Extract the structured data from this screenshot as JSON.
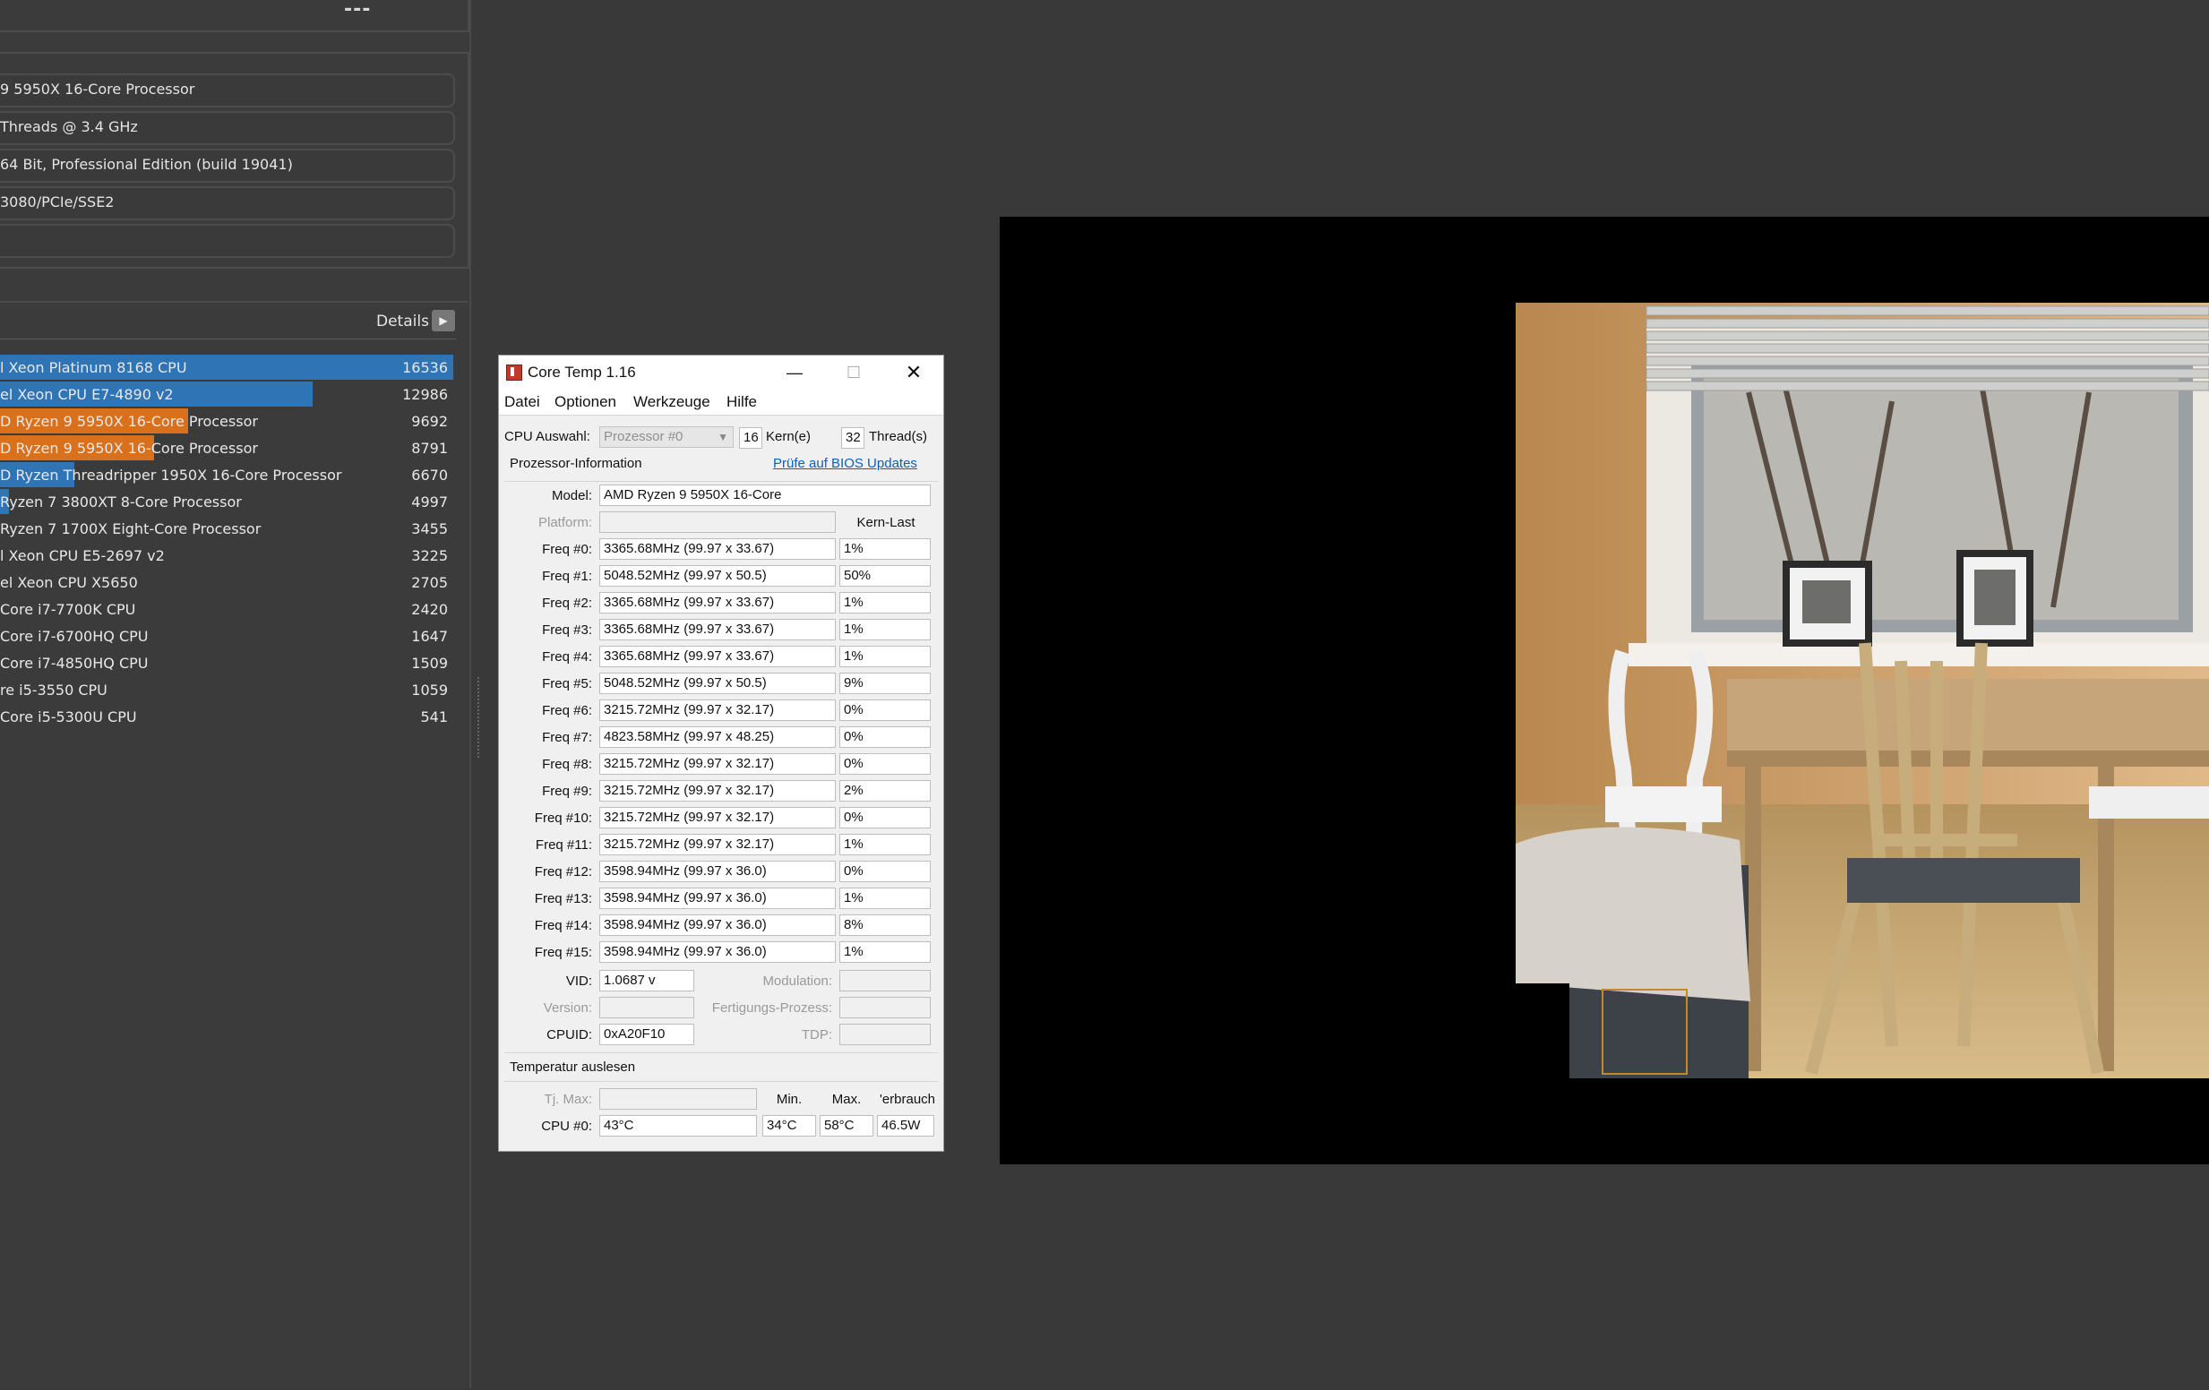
{
  "left_panel": {
    "top_value": "---",
    "system_info": [
      "9 5950X 16-Core Processor",
      "Threads @ 3.4 GHz",
      " 64 Bit, Professional Edition (build 19041)",
      "3080/PCIe/SSE2",
      ""
    ],
    "details_label": "Details",
    "ranking": [
      {
        "name": "l Xeon Platinum 8168 CPU",
        "score": 16536,
        "bar_color": "#2f74b5",
        "bar_fraction": 1.0
      },
      {
        "name": "el Xeon CPU E7-4890 v2",
        "score": 12986,
        "bar_color": "#2f74b5",
        "bar_fraction": 0.69
      },
      {
        "name": "D Ryzen 9 5950X 16-Core Processor",
        "score": 9692,
        "bar_color": "#d9711c",
        "bar_fraction": 0.415
      },
      {
        "name": "D Ryzen 9 5950X 16-Core Processor",
        "score": 8791,
        "bar_color": "#d9711c",
        "bar_fraction": 0.34
      },
      {
        "name": "D Ryzen Threadripper 1950X 16-Core Processor",
        "score": 6670,
        "bar_color": "#2f74b5",
        "bar_fraction": 0.165
      },
      {
        "name": " Ryzen 7 3800XT 8-Core Processor",
        "score": 4997,
        "bar_color": "#2f74b5",
        "bar_fraction": 0.02
      },
      {
        "name": " Ryzen 7 1700X Eight-Core Processor",
        "score": 3455,
        "bar_color": "#2f74b5",
        "bar_fraction": 0
      },
      {
        "name": "l Xeon CPU E5-2697 v2",
        "score": 3225,
        "bar_color": "#2f74b5",
        "bar_fraction": 0
      },
      {
        "name": "el Xeon CPU X5650",
        "score": 2705,
        "bar_color": "#2f74b5",
        "bar_fraction": 0
      },
      {
        "name": " Core i7-7700K CPU",
        "score": 2420,
        "bar_color": "#2f74b5",
        "bar_fraction": 0
      },
      {
        "name": " Core i7-6700HQ CPU",
        "score": 1647,
        "bar_color": "#2f74b5",
        "bar_fraction": 0
      },
      {
        "name": " Core i7-4850HQ CPU",
        "score": 1509,
        "bar_color": "#2f74b5",
        "bar_fraction": 0
      },
      {
        "name": "re i5-3550 CPU",
        "score": 1059,
        "bar_color": "#2f74b5",
        "bar_fraction": 0
      },
      {
        "name": " Core i5-5300U CPU",
        "score": 541,
        "bar_color": "#2f74b5",
        "bar_fraction": 0
      }
    ]
  },
  "coretemp": {
    "title": "Core Temp 1.16",
    "window_buttons": {
      "minimize": "—",
      "maximize": "☐",
      "close": "✕"
    },
    "menu": [
      "Datei",
      "Optionen",
      "Werkzeuge",
      "Hilfe"
    ],
    "cpu_select_label": "CPU Auswahl:",
    "cpu_select_value": "Prozessor #0",
    "cores_value": "16",
    "cores_label": "Kern(e)",
    "threads_value": "32",
    "threads_label": "Thread(s)",
    "processor_info_title": "Prozessor-Information",
    "bios_link": "Prüfe auf BIOS Updates",
    "model_label": "Model:",
    "model_value": "AMD Ryzen 9 5950X 16-Core",
    "platform_label": "Platform:",
    "load_header": "Kern-Last",
    "freqs": [
      {
        "label": "Freq #0:",
        "value": "3365.68MHz (99.97 x 33.67)",
        "load": "1%"
      },
      {
        "label": "Freq #1:",
        "value": "5048.52MHz (99.97 x 50.5)",
        "load": "50%"
      },
      {
        "label": "Freq #2:",
        "value": "3365.68MHz (99.97 x 33.67)",
        "load": "1%"
      },
      {
        "label": "Freq #3:",
        "value": "3365.68MHz (99.97 x 33.67)",
        "load": "1%"
      },
      {
        "label": "Freq #4:",
        "value": "3365.68MHz (99.97 x 33.67)",
        "load": "1%"
      },
      {
        "label": "Freq #5:",
        "value": "5048.52MHz (99.97 x 50.5)",
        "load": "9%"
      },
      {
        "label": "Freq #6:",
        "value": "3215.72MHz (99.97 x 32.17)",
        "load": "0%"
      },
      {
        "label": "Freq #7:",
        "value": "4823.58MHz (99.97 x 48.25)",
        "load": "0%"
      },
      {
        "label": "Freq #8:",
        "value": "3215.72MHz (99.97 x 32.17)",
        "load": "0%"
      },
      {
        "label": "Freq #9:",
        "value": "3215.72MHz (99.97 x 32.17)",
        "load": "2%"
      },
      {
        "label": "Freq #10:",
        "value": "3215.72MHz (99.97 x 32.17)",
        "load": "0%"
      },
      {
        "label": "Freq #11:",
        "value": "3215.72MHz (99.97 x 32.17)",
        "load": "1%"
      },
      {
        "label": "Freq #12:",
        "value": "3598.94MHz (99.97 x 36.0)",
        "load": "0%"
      },
      {
        "label": "Freq #13:",
        "value": "3598.94MHz (99.97 x 36.0)",
        "load": "1%"
      },
      {
        "label": "Freq #14:",
        "value": "3598.94MHz (99.97 x 36.0)",
        "load": "8%"
      },
      {
        "label": "Freq #15:",
        "value": "3598.94MHz (99.97 x 36.0)",
        "load": "1%"
      }
    ],
    "vid_label": "VID:",
    "vid_value": "1.0687 v",
    "modulation_label": "Modulation:",
    "version_label": "Version:",
    "process_label": "Fertigungs-Prozess:",
    "cpuid_label": "CPUID:",
    "cpuid_value": "0xA20F10",
    "tdp_label": "TDP:",
    "temp_title": "Temperatur auslesen",
    "tjmax_label": "Tj. Max:",
    "min_header": "Min.",
    "max_header": "Max.",
    "power_header": "'erbrauch",
    "cpu0_label": "CPU #0:",
    "cpu0_temp": "43°C",
    "cpu0_min": "34°C",
    "cpu0_max": "58°C",
    "cpu0_power": "46.5W"
  }
}
